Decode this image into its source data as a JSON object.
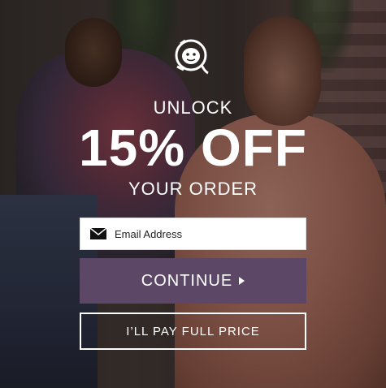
{
  "popup": {
    "headline_top": "UNLOCK",
    "headline_big": "15% OFF",
    "headline_bottom": "YOUR ORDER",
    "email_placeholder": "Email Address",
    "email_value": "",
    "continue_label": "CONTINUE",
    "decline_label": "I’LL PAY FULL PRICE"
  },
  "icons": {
    "logo": "astronaut-helmet-icon",
    "email": "envelope-icon",
    "continue_arrow": "caret-right-icon"
  },
  "colors": {
    "accent": "#5c4766",
    "text": "#ffffff"
  }
}
